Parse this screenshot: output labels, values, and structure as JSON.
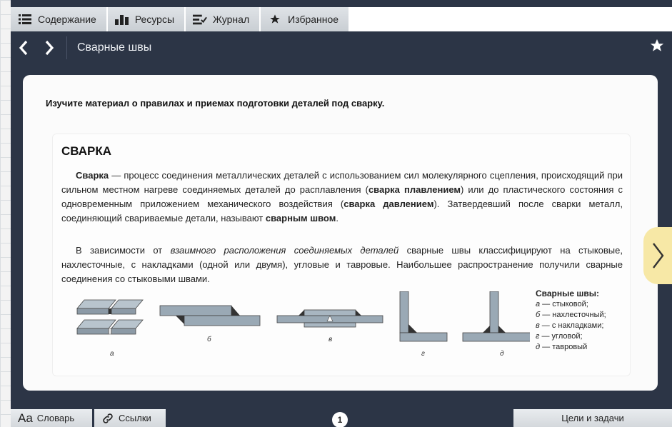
{
  "tabs": [
    {
      "label": "Содержание",
      "icon": "list-icon"
    },
    {
      "label": "Ресурсы",
      "icon": "bar-chart-icon"
    },
    {
      "label": "Журнал",
      "icon": "journal-check-icon"
    },
    {
      "label": "Избранное",
      "icon": "star-icon"
    }
  ],
  "header": {
    "back_icon": "chevron-left-icon",
    "forward_icon": "chevron-right-icon",
    "title": "Сварные швы",
    "favorite_icon": "star-icon"
  },
  "content": {
    "instruction": "Изучите материал о правилах и приемах подготовки деталей под сварку.",
    "section_title": "СВАРКА",
    "p1": {
      "t1": "Сварка",
      "t2": " — процесс соединения металлических деталей с использованием сил молекулярного сцепления, происходящий при сильном местном нагреве соединяемых деталей до расплавления (",
      "t3": "сварка плавлением",
      "t4": ") или до пластического состояния с одновременным приложением механического воздействия (",
      "t5": "сварка давлением",
      "t6": "). Затвердевший после сварки металл, соединяющий свариваемые детали, называют ",
      "t7": "сварным швом",
      "t8": "."
    },
    "p2": {
      "t1": "В зависимости от ",
      "t2": "взаимного расположения соединяемых деталей",
      "t3": " сварные швы классифицируют на стыковые, нахлесточные, с накладками (одной или двумя), угловые и тавровые. Наибольшее распространение получили сварные соединения со стыковыми швами."
    },
    "figure_labels": [
      "а",
      "б",
      "в",
      "г",
      "д"
    ],
    "legend": {
      "title": "Сварные швы:",
      "items": [
        {
          "letter": "а",
          "text": " — стыковой;"
        },
        {
          "letter": "б",
          "text": " — нахлесточный;"
        },
        {
          "letter": "в",
          "text": " — с накладками;"
        },
        {
          "letter": "г",
          "text": " — угловой;"
        },
        {
          "letter": "д",
          "text": " — тавровый"
        }
      ]
    },
    "next_icon": "chevron-right-icon"
  },
  "bottom": {
    "dict_icon": "Aa",
    "dict_label": "Словарь",
    "links_icon": "link-icon",
    "links_label": "Ссылки",
    "page_number": "1",
    "goals_label": "Цели и задачи"
  },
  "colors": {
    "app_bg": "#2c3546",
    "tab_bg": "#d4d8dc",
    "next_tab": "#f7e8a6",
    "weld_steel": "#9aa9b5"
  }
}
